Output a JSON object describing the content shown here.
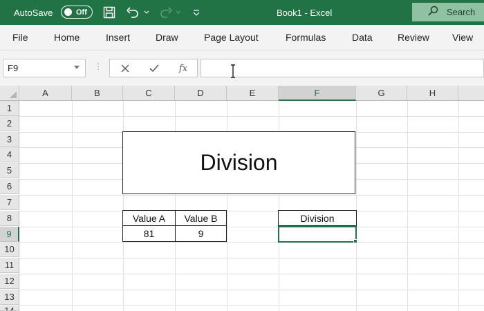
{
  "titlebar": {
    "autosave_label": "AutoSave",
    "autosave_state": "Off",
    "doc_title": "Book1  -  Excel",
    "search_label": "Search",
    "icons": [
      "save-icon",
      "undo-icon",
      "redo-icon",
      "customize-toolbar-icon",
      "search-icon"
    ]
  },
  "menu": {
    "items": [
      "File",
      "Home",
      "Insert",
      "Draw",
      "Page Layout",
      "Formulas",
      "Data",
      "Review",
      "View"
    ]
  },
  "formula_bar": {
    "name_box": "F9",
    "formula": "",
    "icons": [
      "cancel-icon",
      "enter-icon",
      "insert-function-icon"
    ]
  },
  "sheet": {
    "columns": [
      "A",
      "B",
      "C",
      "D",
      "E",
      "F",
      "G",
      "H"
    ],
    "rows": [
      "1",
      "2",
      "3",
      "4",
      "5",
      "6",
      "7",
      "8",
      "9",
      "10",
      "11",
      "12",
      "13",
      "14"
    ],
    "active_column": "F",
    "active_row": "9",
    "title_text": "Division",
    "table": {
      "header_a": "Value A",
      "header_b": "Value B",
      "value_a": "81",
      "value_b": "9",
      "result_header": "Division",
      "result_value": ""
    }
  },
  "colors": {
    "accent": "#217346",
    "search_box": "#8fc2a2",
    "ribbon_bg": "#f3f3f3"
  }
}
